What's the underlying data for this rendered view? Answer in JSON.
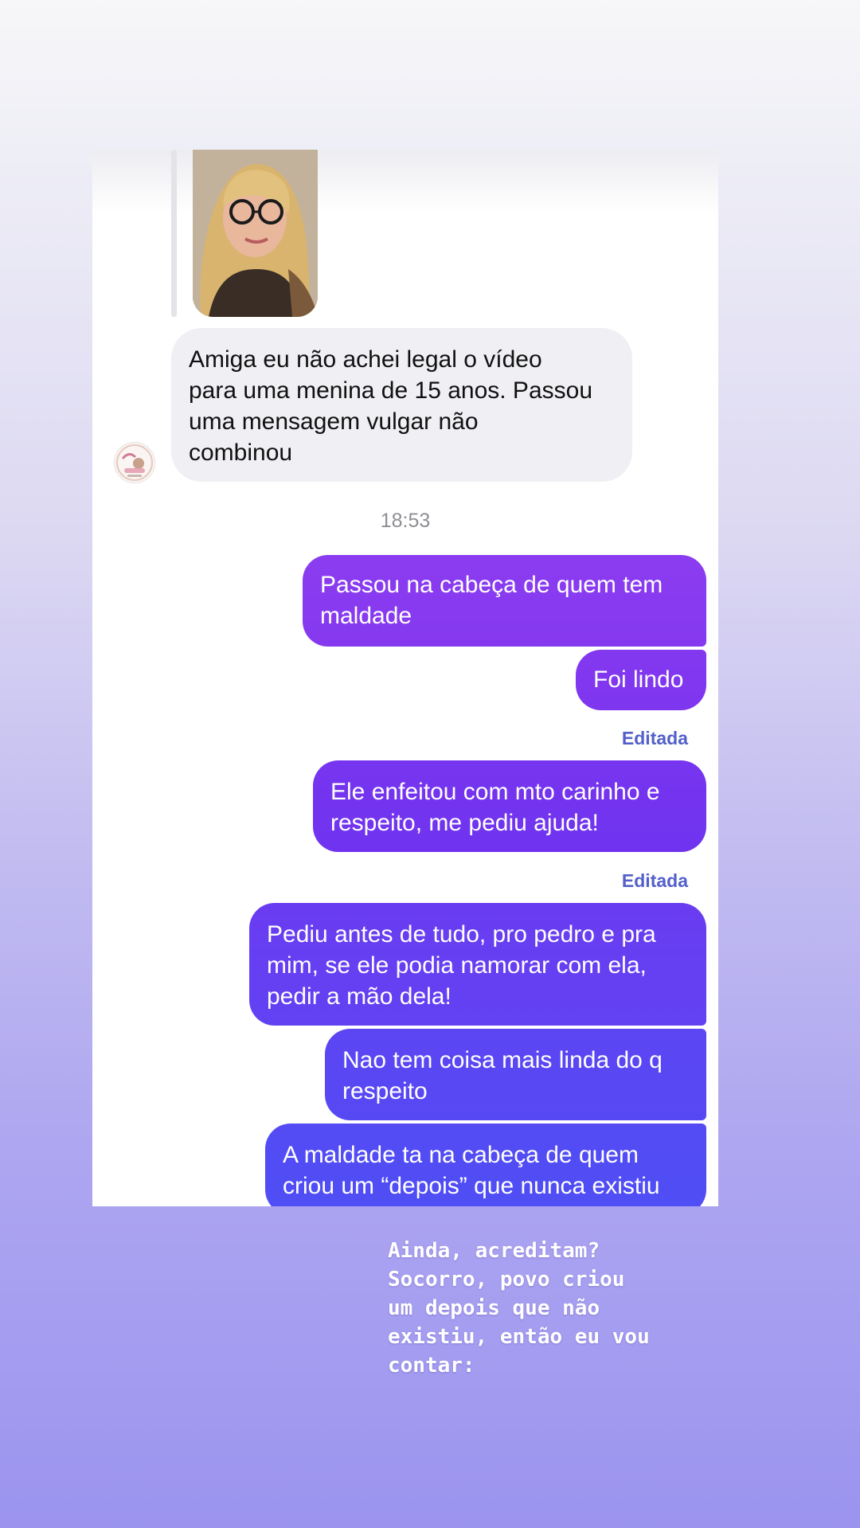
{
  "conversation": {
    "incoming_message": {
      "text": "Amiga eu não achei legal o vídeo\npara uma menina de 15 anos. Passou\numa mensagem vulgar não\ncombinou"
    },
    "timestamp": "18:53",
    "outgoing_messages": [
      {
        "text": "Passou na cabeça de quem tem\nmaldade",
        "edited_label": ""
      },
      {
        "text": "Foi lindo",
        "edited_label": ""
      },
      {
        "text": "Ele enfeitou com mto carinho e\nrespeito, me pediu ajuda!",
        "edited_label": "Editada"
      },
      {
        "text": "Pediu antes de tudo, pro pedro e pra\nmim, se ele podia namorar com ela,\npedir a mão dela!",
        "edited_label": "Editada"
      },
      {
        "text": "Nao tem coisa mais linda do q\nrespeito",
        "edited_label": ""
      },
      {
        "text": "A maldade ta na cabeça de quem\ncriou um “depois” que nunca existiu",
        "edited_label": ""
      }
    ],
    "colors": {
      "incoming_bubble": "#efeff4",
      "outgoing_gradient_top": "#8a3cf0",
      "outgoing_gradient_bottom": "#4f47f5",
      "edited_label": "#5360c9"
    }
  },
  "story_caption": "Ainda, acreditam?\nSocorro, povo criou\num depois que não\nexistiu, então eu vou\ncontar:"
}
